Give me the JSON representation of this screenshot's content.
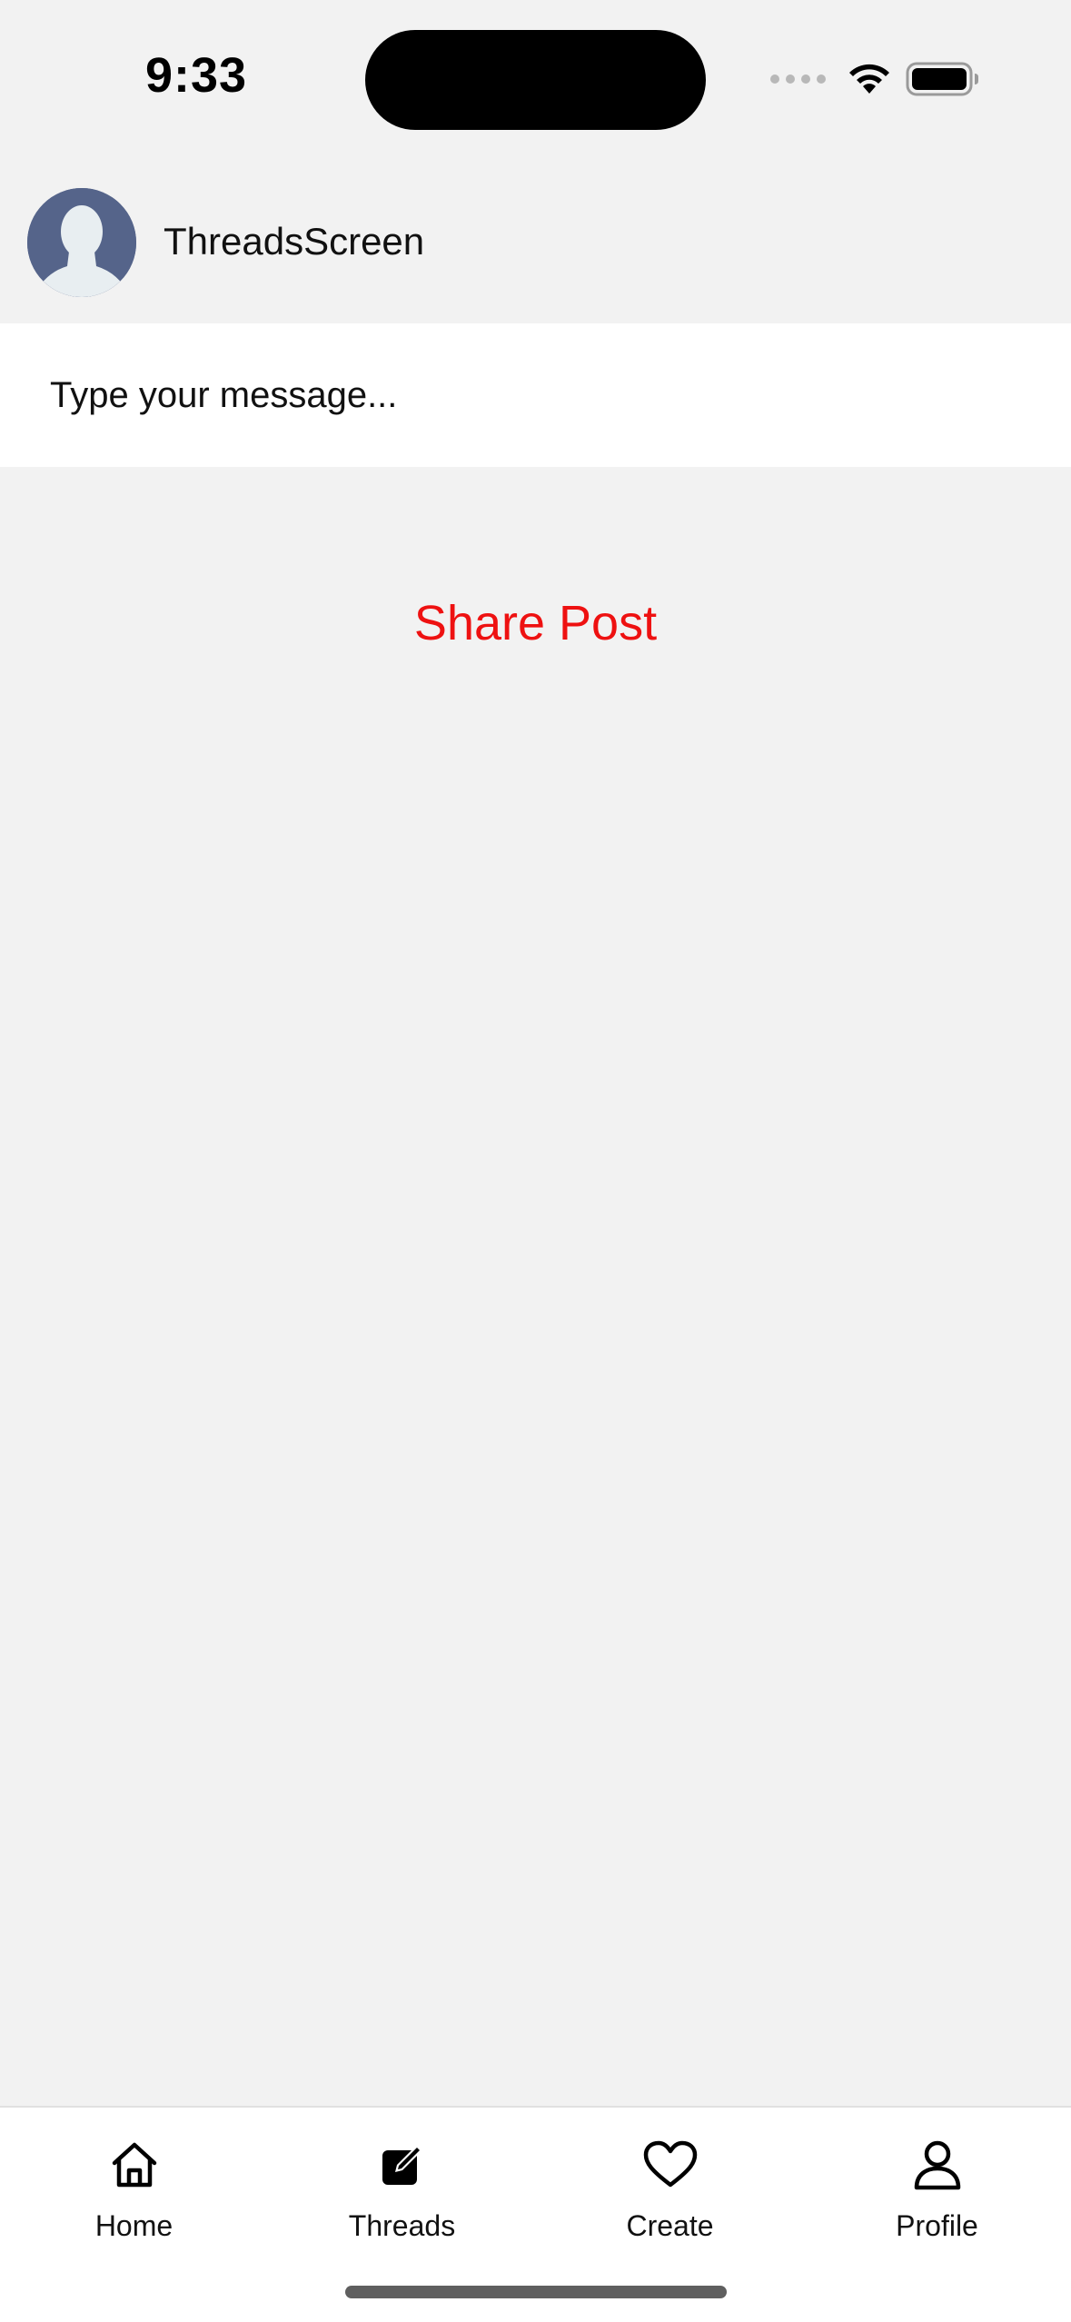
{
  "status_bar": {
    "time": "9:33",
    "icons": [
      "cellular-signal-icon",
      "wifi-icon",
      "battery-icon"
    ]
  },
  "header": {
    "title": "ThreadsScreen",
    "avatar_icon": "default-person-avatar"
  },
  "composer": {
    "placeholder": "Type your message..."
  },
  "actions": {
    "share_label": "Share Post",
    "share_color": "#ee1111"
  },
  "tab_bar": {
    "tabs": [
      {
        "label": "Home",
        "icon": "home-icon"
      },
      {
        "label": "Threads",
        "icon": "compose-icon"
      },
      {
        "label": "Create",
        "icon": "heart-icon"
      },
      {
        "label": "Profile",
        "icon": "person-icon"
      }
    ]
  }
}
